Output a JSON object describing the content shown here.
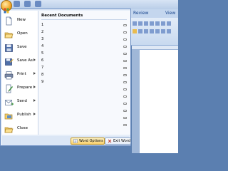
{
  "ribbon": {
    "tab_review": "Review",
    "tab_view": "View"
  },
  "menu": {
    "left_items": [
      {
        "label": "New",
        "icon": "new-document-icon",
        "has_submenu": false
      },
      {
        "label": "Open",
        "icon": "open-folder-icon",
        "has_submenu": false
      },
      {
        "label": "Save",
        "icon": "save-disk-icon",
        "has_submenu": false
      },
      {
        "label": "Save As",
        "icon": "save-as-icon",
        "has_submenu": true
      },
      {
        "label": "Print",
        "icon": "printer-icon",
        "has_submenu": true
      },
      {
        "label": "Prepare",
        "icon": "prepare-icon",
        "has_submenu": true
      },
      {
        "label": "Send",
        "icon": "send-icon",
        "has_submenu": true
      },
      {
        "label": "Publish",
        "icon": "publish-icon",
        "has_submenu": true
      },
      {
        "label": "Close",
        "icon": "close-folder-icon",
        "has_submenu": false
      }
    ],
    "recent": {
      "title": "Recent Documents",
      "items": [
        "1",
        "2",
        "3",
        "4",
        "5",
        "6",
        "7",
        "8",
        "9"
      ]
    },
    "buttons": {
      "options": "Word Options",
      "exit": "Exit Word"
    }
  },
  "colors": {
    "accent": "#f3a623",
    "menu_border": "#6d8fc4"
  }
}
